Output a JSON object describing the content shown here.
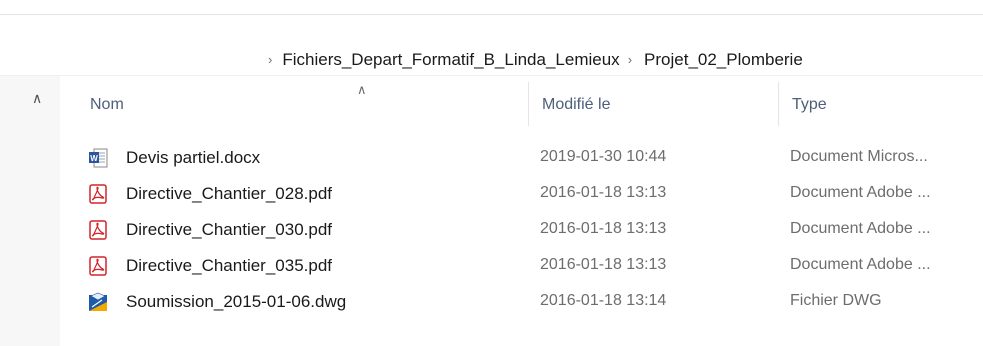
{
  "breadcrumb": {
    "items": [
      "Fichiers_Depart_Formatif_B_Linda_Lemieux",
      "Projet_02_Plomberie"
    ]
  },
  "columns": {
    "name": "Nom",
    "modified": "Modifié le",
    "type": "Type"
  },
  "files": [
    {
      "name": "Devis partiel.docx",
      "modified": "2019-01-30 10:44",
      "type": "Document Micros...",
      "icon": "word-document-icon"
    },
    {
      "name": "Directive_Chantier_028.pdf",
      "modified": "2016-01-18 13:13",
      "type": "Document Adobe ...",
      "icon": "pdf-icon"
    },
    {
      "name": "Directive_Chantier_030.pdf",
      "modified": "2016-01-18 13:13",
      "type": "Document Adobe ...",
      "icon": "pdf-icon"
    },
    {
      "name": "Directive_Chantier_035.pdf",
      "modified": "2016-01-18 13:13",
      "type": "Document Adobe ...",
      "icon": "pdf-icon"
    },
    {
      "name": "Soumission_2015-01-06.dwg",
      "modified": "2016-01-18 13:14",
      "type": "Fichier DWG",
      "icon": "dwg-file-icon"
    }
  ],
  "colors": {
    "header_text": "#4c607a",
    "secondary_text": "#6d6d6d",
    "pdf_red": "#d2232a",
    "word_blue": "#2b579a"
  }
}
